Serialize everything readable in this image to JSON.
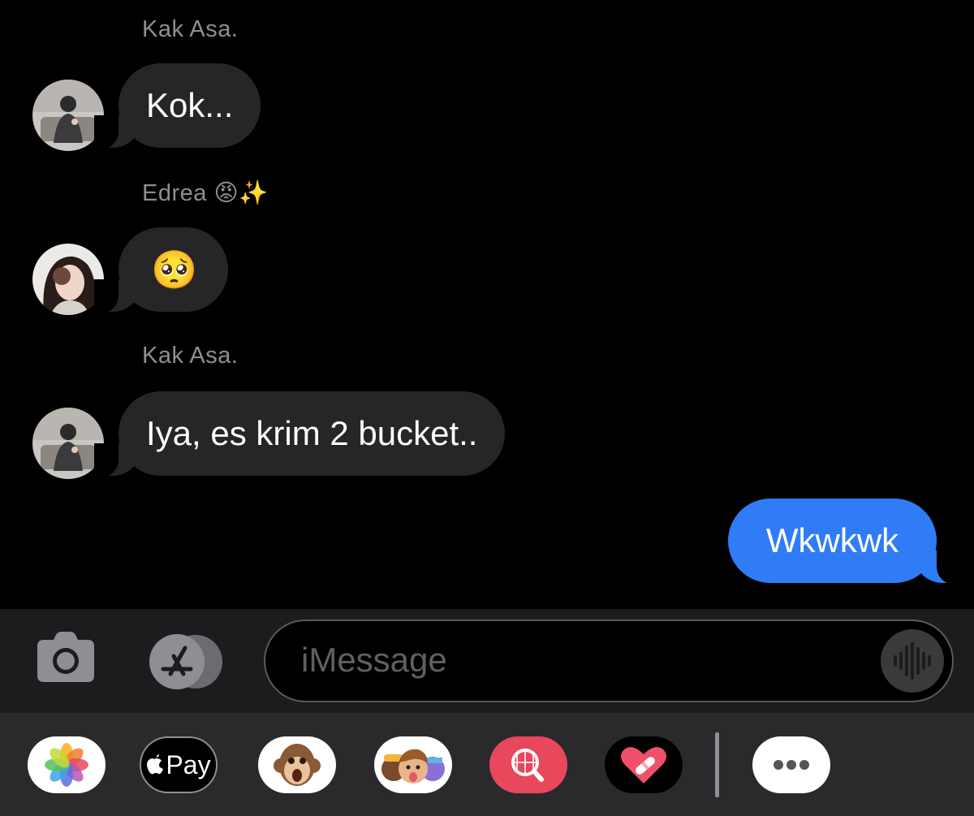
{
  "messages": [
    {
      "sender": "Kak Asa.",
      "text": "Kok...",
      "direction": "incoming"
    },
    {
      "sender": "Edrea 😡✨",
      "text": "🥺",
      "direction": "incoming"
    },
    {
      "sender": "Kak Asa.",
      "text": "Iya, es krim 2 bucket..",
      "direction": "incoming"
    },
    {
      "sender": "",
      "text": "Wkwkwk",
      "direction": "outgoing"
    }
  ],
  "compose": {
    "placeholder": "iMessage",
    "camera_icon": "camera-icon",
    "apps_icon": "app-store-icon",
    "voice_icon": "waveform-icon"
  },
  "app_drawer": {
    "apps": [
      "photos-icon",
      "apple-pay-icon",
      "monkey-animoji-icon",
      "memoji-icon",
      "images-search-icon",
      "digital-touch-icon",
      "more-icon"
    ],
    "apple_pay_label": "Pay"
  },
  "colors": {
    "incoming_bubble": "#262628",
    "outgoing_bubble": "#2f7cf6",
    "background": "#000000"
  }
}
